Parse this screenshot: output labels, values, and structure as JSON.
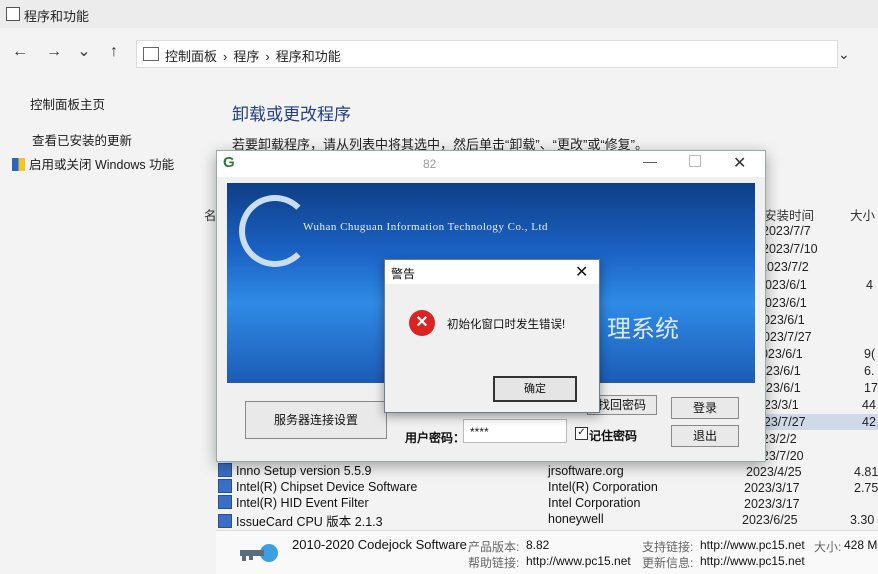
{
  "window": {
    "title": "程序和功能"
  },
  "nav": {
    "back": "←",
    "forward": "→",
    "recent": "⌄",
    "up": "↑",
    "dropdown": "⌄",
    "breadcrumb": [
      "控制面板",
      "›",
      "程序",
      "›",
      "程序和功能"
    ],
    "sep": "›"
  },
  "sidebar": {
    "home": "控制面板主页",
    "updates": "查看已安装的更新",
    "features": "启用或关闭 Windows 功能"
  },
  "main": {
    "heading": "卸载或更改程序",
    "instruction": "若要卸载程序，请从列表中将其选中，然后单击“卸载”、“更改”或“修复”。",
    "col_name": "名",
    "col_date": "安装时间",
    "col_size": "大小"
  },
  "dates": [
    "2023/7/7",
    "2023/7/10",
    "2023/7/2",
    "2023/6/1",
    "2023/6/1",
    "2023/6/1",
    "2023/7/27",
    "2023/6/1",
    "2023/6/1",
    "2023/6/1",
    "2023/3/1",
    "2023/7/27",
    "2023/2/2",
    "2023/7/20",
    "2023/4/25",
    "2023/3/17",
    "2023/3/17",
    "2023/6/25"
  ],
  "sizes": [
    "4",
    "9(",
    "6.",
    "17",
    "44",
    "42",
    "4.81",
    "2.75",
    "3.30"
  ],
  "programs": [
    {
      "name": "Inno Setup version 5.5.9",
      "publisher": "jrsoftware.org"
    },
    {
      "name": "Intel(R) Chipset Device Software",
      "publisher": "Intel(R) Corporation"
    },
    {
      "name": "Intel(R) HID Event Filter",
      "publisher": "Intel Corporation"
    },
    {
      "name": "IssueCard CPU 版本 2.1.3",
      "publisher": "honeywell"
    }
  ],
  "status": {
    "name": "2010-2020 Codejock Software",
    "version_label": "产品版本:",
    "version": "8.82",
    "support_label": "支持链接:",
    "support": "http://www.pc15.net",
    "size_label": "大小:",
    "size": "428 M",
    "help_label": "帮助链接:",
    "help": "http://www.pc15.net",
    "update_label": "更新信息:",
    "update": "http://www.pc15.net"
  },
  "app": {
    "title_icon": "G",
    "title": "82",
    "minimize": "—",
    "close": "✕",
    "banner_en": "Wuhan Chuguan Information Technology Co., Ltd",
    "banner_sys": "理系统",
    "server_btn": "服务器连接设置",
    "retrieve_btn": "找回密码",
    "login_btn": "登录",
    "exit_btn": "退出",
    "pwd_label": "用户密码：",
    "pwd_value": "****",
    "remember": "记住密码",
    "check": "✓"
  },
  "warning": {
    "title": "警告",
    "close": "✕",
    "error_glyph": "✕",
    "message": "初始化窗口时发生错误!",
    "ok": "确定"
  },
  "colors": {
    "link": "#1f3f8f",
    "banner": "#1b63c6",
    "error": "#dd2222"
  }
}
